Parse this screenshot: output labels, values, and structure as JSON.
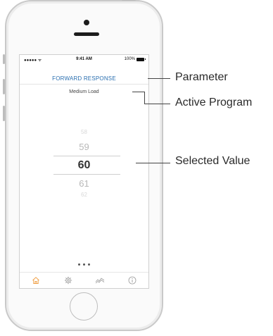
{
  "status_bar": {
    "signal": "●●●●● ᯤ",
    "time": "9:41 AM",
    "battery": "100%"
  },
  "screen": {
    "parameter_title": "FORWARD RESPONSE",
    "active_program": "Medium Load",
    "picker_values": [
      "58",
      "59",
      "60",
      "61",
      "62"
    ],
    "selected_value": "60",
    "page_dots": 3,
    "accent_color": "#2a6fb0",
    "tabs": [
      {
        "icon": "home-icon",
        "active": true,
        "color": "#f0a24a"
      },
      {
        "icon": "gear-icon",
        "active": false
      },
      {
        "icon": "chart-line-icon",
        "active": false
      },
      {
        "icon": "info-icon",
        "active": false
      }
    ]
  },
  "callouts": {
    "parameter": "Parameter",
    "active_program": "Active Program",
    "selected_value": "Selected Value"
  }
}
